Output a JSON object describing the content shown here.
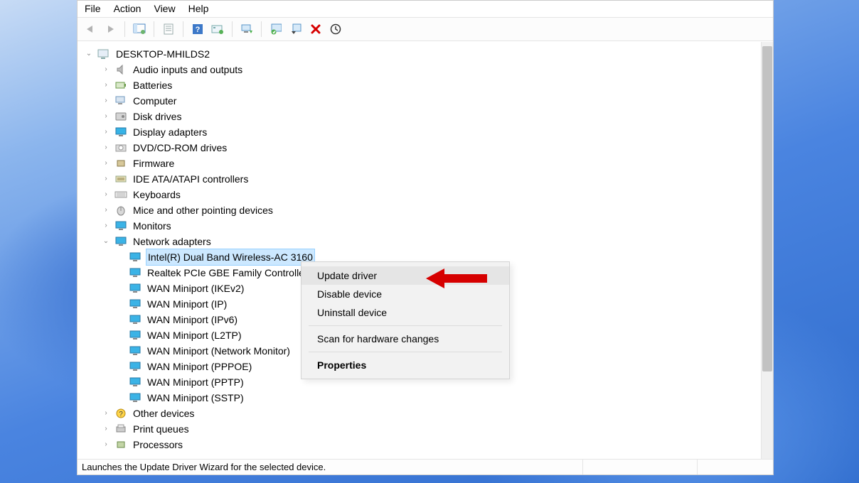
{
  "menu": {
    "file": "File",
    "action": "Action",
    "view": "View",
    "help": "Help"
  },
  "tree": {
    "root": "DESKTOP-MHILDS2",
    "cat": {
      "audio": "Audio inputs and outputs",
      "batt": "Batteries",
      "computer": "Computer",
      "disk": "Disk drives",
      "display": "Display adapters",
      "dvd": "DVD/CD-ROM drives",
      "firmware": "Firmware",
      "ide": "IDE ATA/ATAPI controllers",
      "keyboards": "Keyboards",
      "mice": "Mice and other pointing devices",
      "monitors": "Monitors",
      "network": "Network adapters",
      "other": "Other devices",
      "printq": "Print queues",
      "proc": "Processors"
    },
    "net": [
      "Intel(R) Dual Band Wireless-AC 3160",
      "Realtek PCIe GBE Family Controller",
      "WAN Miniport (IKEv2)",
      "WAN Miniport (IP)",
      "WAN Miniport (IPv6)",
      "WAN Miniport (L2TP)",
      "WAN Miniport (Network Monitor)",
      "WAN Miniport (PPPOE)",
      "WAN Miniport (PPTP)",
      "WAN Miniport (SSTP)"
    ]
  },
  "ctx": {
    "update": "Update driver",
    "disable": "Disable device",
    "uninstall": "Uninstall device",
    "scan": "Scan for hardware changes",
    "props": "Properties"
  },
  "status": "Launches the Update Driver Wizard for the selected device.",
  "colors": {
    "selection": "#cce8ff",
    "arrow": "#d60000"
  }
}
